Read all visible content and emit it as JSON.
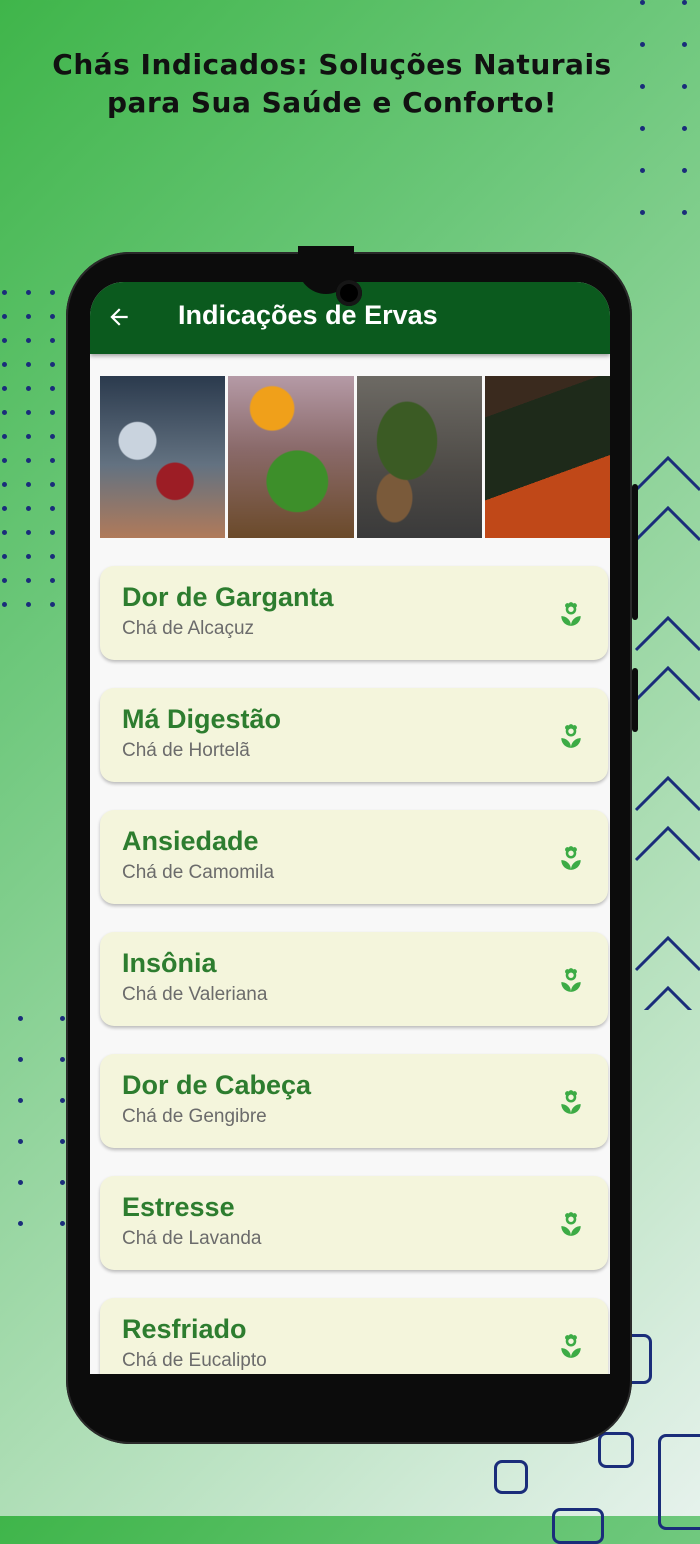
{
  "headline": {
    "line1": "Chás Indicados: Soluções Naturais",
    "line2": "para Sua Saúde e Conforto!"
  },
  "app": {
    "title": "Indicações de Ervas",
    "back_icon": "arrow-left-icon"
  },
  "banner": {
    "photos": [
      "tea-glass-photo",
      "herbs-teapot-photo",
      "green-tea-spoon-photo",
      "tea-boxes-photo"
    ]
  },
  "list": {
    "items": [
      {
        "title": "Dor de Garganta",
        "subtitle": "Chá de Alcaçuz",
        "icon": "flower-icon"
      },
      {
        "title": "Má Digestão",
        "subtitle": "Chá de Hortelã",
        "icon": "flower-icon"
      },
      {
        "title": "Ansiedade",
        "subtitle": "Chá de Camomila",
        "icon": "flower-icon"
      },
      {
        "title": "Insônia",
        "subtitle": "Chá de Valeriana",
        "icon": "flower-icon"
      },
      {
        "title": "Dor de Cabeça",
        "subtitle": "Chá de Gengibre",
        "icon": "flower-icon"
      },
      {
        "title": "Estresse",
        "subtitle": "Chá de Lavanda",
        "icon": "flower-icon"
      },
      {
        "title": "Resfriado",
        "subtitle": "Chá de Eucalipto",
        "icon": "flower-icon"
      }
    ]
  },
  "colors": {
    "appbar": "#0b5a1e",
    "card_bg": "#f4f5dc",
    "card_title": "#2d7d2f",
    "icon": "#3cab45",
    "accent_decoration": "#1a2d7a"
  }
}
